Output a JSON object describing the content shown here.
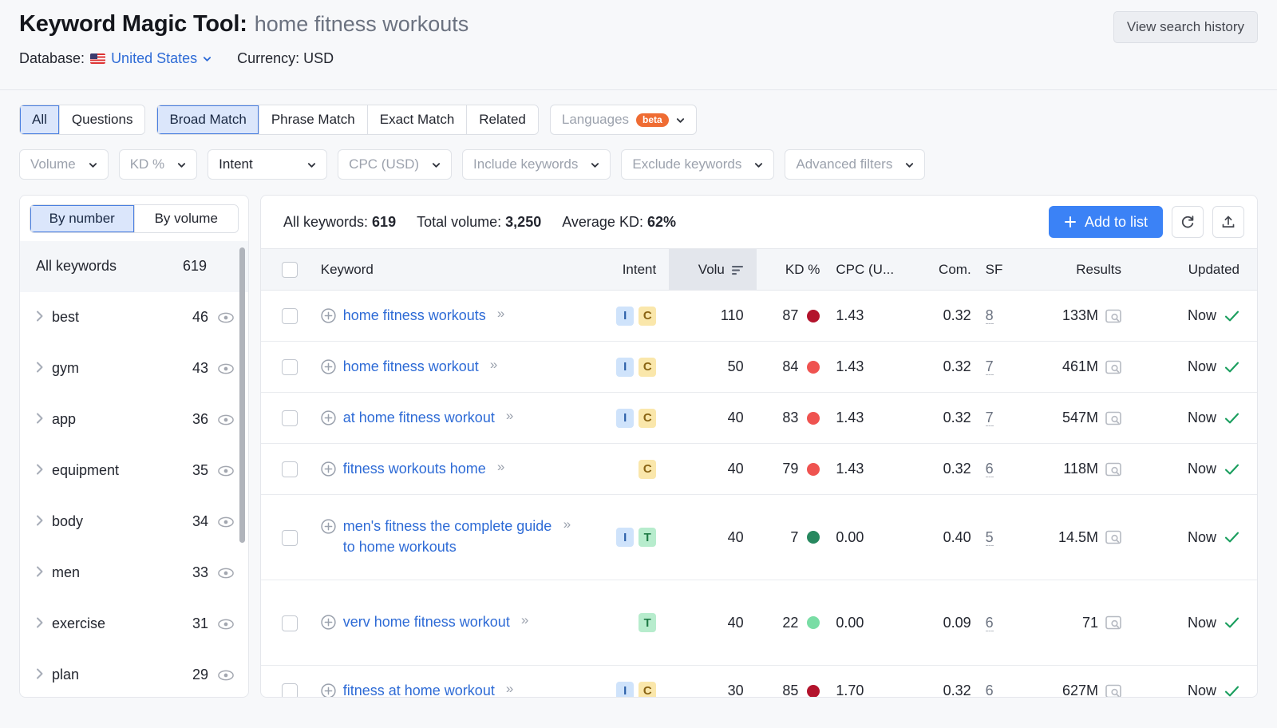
{
  "header": {
    "title_main": "Keyword Magic Tool:",
    "title_query": "home fitness workouts",
    "database_label": "Database:",
    "database_value": "United States",
    "currency_label": "Currency: USD",
    "history_button": "View search history"
  },
  "filters": {
    "match_group_1": [
      {
        "label": "All",
        "active": true
      },
      {
        "label": "Questions",
        "active": false
      }
    ],
    "match_group_2": [
      {
        "label": "Broad Match",
        "active": true
      },
      {
        "label": "Phrase Match",
        "active": false
      },
      {
        "label": "Exact Match",
        "active": false
      },
      {
        "label": "Related",
        "active": false
      }
    ],
    "languages": {
      "label": "Languages",
      "badge": "beta"
    },
    "dropdowns": [
      {
        "label": "Volume",
        "dark": false
      },
      {
        "label": "KD %",
        "dark": false
      },
      {
        "label": "Intent",
        "dark": true
      },
      {
        "label": "CPC (USD)",
        "dark": false
      },
      {
        "label": "Include keywords",
        "dark": false
      },
      {
        "label": "Exclude keywords",
        "dark": false
      },
      {
        "label": "Advanced filters",
        "dark": false
      }
    ]
  },
  "sidebar": {
    "toggle": [
      {
        "label": "By number",
        "active": true
      },
      {
        "label": "By volume",
        "active": false
      }
    ],
    "all_keywords": {
      "label": "All keywords",
      "count": "619"
    },
    "groups": [
      {
        "label": "best",
        "count": "46"
      },
      {
        "label": "gym",
        "count": "43"
      },
      {
        "label": "app",
        "count": "36"
      },
      {
        "label": "equipment",
        "count": "35"
      },
      {
        "label": "body",
        "count": "34"
      },
      {
        "label": "men",
        "count": "33"
      },
      {
        "label": "exercise",
        "count": "31"
      },
      {
        "label": "plan",
        "count": "29"
      }
    ]
  },
  "panel": {
    "stats": [
      {
        "label": "All keywords:",
        "value": "619"
      },
      {
        "label": "Total volume:",
        "value": "3,250"
      },
      {
        "label": "Average KD:",
        "value": "62%"
      }
    ],
    "add_to_list": "Add to list",
    "columns": [
      "Keyword",
      "Intent",
      "Volu",
      "KD %",
      "CPC (U...",
      "Com.",
      "SF",
      "Results",
      "Updated"
    ],
    "sorted_column": "Volu",
    "sort_direction": "desc",
    "rows": [
      {
        "keyword": "home fitness workouts",
        "intent": [
          "I",
          "C"
        ],
        "volume": "110",
        "kd": "87",
        "kd_color": "#b3132c",
        "cpc": "1.43",
        "com": "0.32",
        "sf": "8",
        "results": "133M",
        "updated": "Now",
        "tall": false
      },
      {
        "keyword": "home fitness workout",
        "intent": [
          "I",
          "C"
        ],
        "volume": "50",
        "kd": "84",
        "kd_color": "#ef5350",
        "cpc": "1.43",
        "com": "0.32",
        "sf": "7",
        "results": "461M",
        "updated": "Now",
        "tall": false
      },
      {
        "keyword": "at home fitness workout",
        "intent": [
          "I",
          "C"
        ],
        "volume": "40",
        "kd": "83",
        "kd_color": "#ef5350",
        "cpc": "1.43",
        "com": "0.32",
        "sf": "7",
        "results": "547M",
        "updated": "Now",
        "tall": false
      },
      {
        "keyword": "fitness workouts home",
        "intent": [
          "C"
        ],
        "volume": "40",
        "kd": "79",
        "kd_color": "#ef5350",
        "cpc": "1.43",
        "com": "0.32",
        "sf": "6",
        "results": "118M",
        "updated": "Now",
        "tall": false
      },
      {
        "keyword": "men's fitness the complete guide to home workouts",
        "intent": [
          "I",
          "T"
        ],
        "volume": "40",
        "kd": "7",
        "kd_color": "#27885f",
        "cpc": "0.00",
        "com": "0.40",
        "sf": "5",
        "results": "14.5M",
        "updated": "Now",
        "tall": true
      },
      {
        "keyword": "verv home fitness workout",
        "intent": [
          "T"
        ],
        "volume": "40",
        "kd": "22",
        "kd_color": "#79dda5",
        "cpc": "0.00",
        "com": "0.09",
        "sf": "6",
        "results": "71",
        "updated": "Now",
        "tall": true
      },
      {
        "keyword": "fitness at home workout",
        "intent": [
          "I",
          "C"
        ],
        "volume": "30",
        "kd": "85",
        "kd_color": "#b3132c",
        "cpc": "1.70",
        "com": "0.32",
        "sf": "6",
        "results": "627M",
        "updated": "Now",
        "tall": false
      }
    ]
  },
  "colors": {
    "accent": "#3b82f6",
    "link": "#2e6bd6",
    "beta": "#ef6c33",
    "check": "#1a9e5e"
  }
}
